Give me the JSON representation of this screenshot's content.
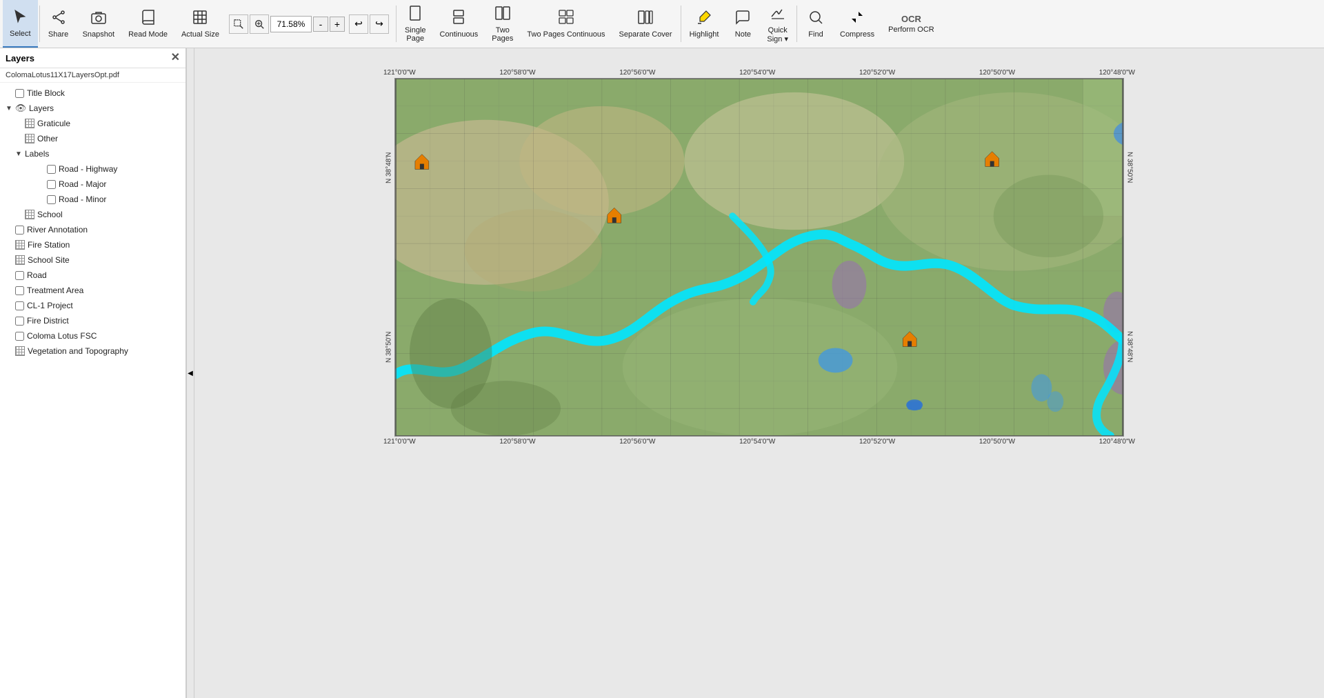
{
  "toolbar": {
    "zoom_value": "71.58%",
    "tools": [
      {
        "id": "select",
        "label": "Select",
        "icon": "cursor",
        "active": true
      },
      {
        "id": "share",
        "label": "Share",
        "icon": "share"
      },
      {
        "id": "snapshot",
        "label": "Snapshot",
        "icon": "camera"
      },
      {
        "id": "read-mode",
        "label": "Read\nMode",
        "icon": "book"
      },
      {
        "id": "actual-size",
        "label": "Actual\nSize",
        "icon": "actual"
      },
      {
        "id": "zoom-marquee",
        "label": "",
        "icon": "marquee"
      },
      {
        "id": "zoom-dynamic",
        "label": "",
        "icon": "dynamic"
      }
    ],
    "zoom_minus": "-",
    "zoom_plus": "+",
    "undo": "↩",
    "redo": "↪",
    "view_tools": [
      {
        "id": "single-page",
        "label": "Single\nPage",
        "icon": "page"
      },
      {
        "id": "continuous",
        "label": "Continuous",
        "icon": "continuous"
      },
      {
        "id": "two-pages",
        "label": "Two\nPages",
        "icon": "twopages"
      },
      {
        "id": "two-pages-continuous",
        "label": "Two Pages\nContinuous",
        "icon": "twopc"
      },
      {
        "id": "separate-cover",
        "label": "Separate\nCover",
        "icon": "cover"
      },
      {
        "id": "highlight",
        "label": "Highlight",
        "icon": "highlight"
      },
      {
        "id": "note",
        "label": "Note",
        "icon": "note"
      },
      {
        "id": "quick-sign",
        "label": "Quick\nSign",
        "icon": "sign"
      },
      {
        "id": "find",
        "label": "Find",
        "icon": "find"
      },
      {
        "id": "compress",
        "label": "Compress",
        "icon": "compress"
      },
      {
        "id": "perform-ocr",
        "label": "Perform\nOCR",
        "icon": "ocr"
      }
    ]
  },
  "layers_panel": {
    "title": "Layers",
    "filename": "ColomaLotus11X17LayersOpt.pdf",
    "items": [
      {
        "id": "title-block",
        "label": "Title Block",
        "indent": 0,
        "type": "checkbox",
        "checked": false,
        "has_arrow": false,
        "has_eye": false
      },
      {
        "id": "layers-group",
        "label": "Layers",
        "indent": 0,
        "type": "group",
        "checked": true,
        "has_arrow": true,
        "expanded": true,
        "has_eye": true
      },
      {
        "id": "graticule",
        "label": "Graticule",
        "indent": 1,
        "type": "eye",
        "has_arrow": false,
        "has_eye": true
      },
      {
        "id": "other",
        "label": "Other",
        "indent": 1,
        "type": "eye",
        "has_arrow": false,
        "has_eye": true
      },
      {
        "id": "labels-group",
        "label": "Labels",
        "indent": 1,
        "type": "group",
        "has_arrow": true,
        "expanded": true,
        "has_eye": false
      },
      {
        "id": "road-highway",
        "label": "Road - Highway",
        "indent": 2,
        "type": "checkbox",
        "checked": false
      },
      {
        "id": "road-major",
        "label": "Road - Major",
        "indent": 2,
        "type": "checkbox",
        "checked": false
      },
      {
        "id": "road-minor",
        "label": "Road - Minor",
        "indent": 2,
        "type": "checkbox",
        "checked": false
      },
      {
        "id": "school",
        "label": "School",
        "indent": 1,
        "type": "eye",
        "has_eye": true
      },
      {
        "id": "river-annotation",
        "label": "River Annotation",
        "indent": 0,
        "type": "checkbox",
        "checked": false
      },
      {
        "id": "fire-station",
        "label": "Fire Station",
        "indent": 0,
        "type": "eye",
        "has_eye": true
      },
      {
        "id": "school-site",
        "label": "School Site",
        "indent": 0,
        "type": "eye",
        "has_eye": true
      },
      {
        "id": "road",
        "label": "Road",
        "indent": 0,
        "type": "checkbox",
        "checked": false
      },
      {
        "id": "treatment-area",
        "label": "Treatment Area",
        "indent": 0,
        "type": "checkbox",
        "checked": false
      },
      {
        "id": "cl1-project",
        "label": "CL-1 Project",
        "indent": 0,
        "type": "checkbox",
        "checked": false
      },
      {
        "id": "fire-district",
        "label": "Fire District",
        "indent": 0,
        "type": "checkbox",
        "checked": false
      },
      {
        "id": "coloma-lotus-fsc",
        "label": "Coloma Lotus FSC",
        "indent": 0,
        "type": "checkbox",
        "checked": false
      },
      {
        "id": "vegetation-topography",
        "label": "Vegetation and Topography",
        "indent": 0,
        "type": "eye",
        "has_eye": true
      }
    ]
  },
  "map": {
    "top_coords": [
      "121°0'0\"W",
      "120°58'0\"W",
      "120°56'0\"W",
      "120°54'0\"W",
      "120°52'0\"W",
      "120°50'0\"W",
      "120°48'0\"W"
    ],
    "bottom_coords": [
      "121°0'0\"W",
      "120°58'0\"W",
      "120°56'0\"W",
      "120°54'0\"W",
      "120°52'0\"W",
      "120°50'0\"W",
      "120°48'0\"W"
    ],
    "left_coords": [
      "N 38°50'N",
      "N 38°48'N"
    ],
    "right_coords": [
      "N 38°50'N",
      "N 38°48'N"
    ]
  }
}
